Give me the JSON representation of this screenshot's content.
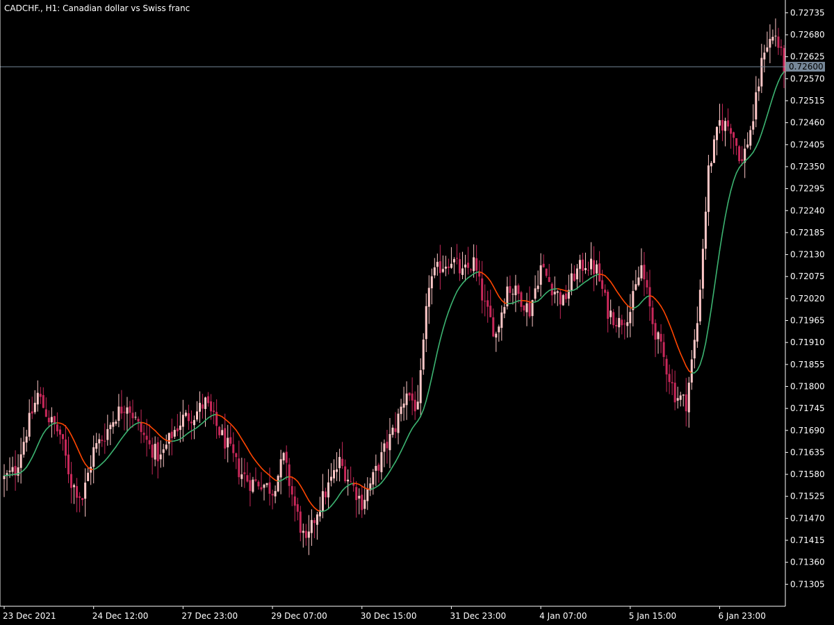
{
  "chart_data": {
    "type": "candlestick",
    "title": "CADCHF., H1:  Canadian dollar vs Swiss franc",
    "symbol": "CADCHF.",
    "timeframe": "H1",
    "description": "Canadian dollar vs Swiss franc",
    "current_price_label": "0.72600",
    "current_price": 0.726,
    "ylim": [
      0.7125,
      0.7276
    ],
    "y_ticks": [
      "0.72735",
      "0.72680",
      "0.72625",
      "0.72570",
      "0.72515",
      "0.72460",
      "0.72405",
      "0.72350",
      "0.72295",
      "0.72240",
      "0.72185",
      "0.72130",
      "0.72075",
      "0.72020",
      "0.71965",
      "0.71910",
      "0.71855",
      "0.71800",
      "0.71745",
      "0.71690",
      "0.71635",
      "0.71580",
      "0.71525",
      "0.71470",
      "0.71415",
      "0.71360",
      "0.71305"
    ],
    "x_ticks": [
      "23 Dec 2021",
      "24 Dec 12:00",
      "27 Dec 23:00",
      "29 Dec 07:00",
      "30 Dec 15:00",
      "31 Dec 23:00",
      "4 Jan 07:00",
      "5 Jan 15:00",
      "6 Jan 23:00"
    ],
    "x_tick_bars": [
      0,
      32,
      64,
      96,
      128,
      160,
      192,
      224,
      256
    ],
    "bar_count": 280,
    "path_points": [
      [
        0,
        0.7157
      ],
      [
        4,
        0.7159
      ],
      [
        8,
        0.7169
      ],
      [
        12,
        0.7178
      ],
      [
        16,
        0.7172
      ],
      [
        20,
        0.7168
      ],
      [
        24,
        0.7156
      ],
      [
        28,
        0.7152
      ],
      [
        32,
        0.7164
      ],
      [
        36,
        0.7168
      ],
      [
        40,
        0.7173
      ],
      [
        44,
        0.7176
      ],
      [
        48,
        0.717
      ],
      [
        52,
        0.7165
      ],
      [
        56,
        0.7162
      ],
      [
        60,
        0.7168
      ],
      [
        64,
        0.7172
      ],
      [
        68,
        0.7173
      ],
      [
        72,
        0.7176
      ],
      [
        76,
        0.717
      ],
      [
        80,
        0.7165
      ],
      [
        84,
        0.7159
      ],
      [
        88,
        0.7156
      ],
      [
        92,
        0.7156
      ],
      [
        96,
        0.7154
      ],
      [
        100,
        0.7162
      ],
      [
        104,
        0.715
      ],
      [
        108,
        0.714
      ],
      [
        112,
        0.7149
      ],
      [
        116,
        0.7155
      ],
      [
        120,
        0.7161
      ],
      [
        124,
        0.7156
      ],
      [
        128,
        0.7151
      ],
      [
        132,
        0.7157
      ],
      [
        136,
        0.7164
      ],
      [
        140,
        0.717
      ],
      [
        144,
        0.7179
      ],
      [
        148,
        0.7174
      ],
      [
        152,
        0.7206
      ],
      [
        156,
        0.721
      ],
      [
        160,
        0.7212
      ],
      [
        164,
        0.7208
      ],
      [
        168,
        0.7211
      ],
      [
        172,
        0.72
      ],
      [
        176,
        0.7193
      ],
      [
        180,
        0.7205
      ],
      [
        184,
        0.7203
      ],
      [
        188,
        0.7199
      ],
      [
        192,
        0.721
      ],
      [
        196,
        0.7205
      ],
      [
        200,
        0.7201
      ],
      [
        204,
        0.7208
      ],
      [
        208,
        0.7211
      ],
      [
        212,
        0.7209
      ],
      [
        216,
        0.7199
      ],
      [
        220,
        0.7196
      ],
      [
        224,
        0.7199
      ],
      [
        228,
        0.721
      ],
      [
        232,
        0.7196
      ],
      [
        236,
        0.7187
      ],
      [
        240,
        0.7178
      ],
      [
        244,
        0.7176
      ],
      [
        248,
        0.7196
      ],
      [
        252,
        0.7234
      ],
      [
        256,
        0.7246
      ],
      [
        260,
        0.7245
      ],
      [
        264,
        0.7236
      ],
      [
        268,
        0.7247
      ],
      [
        272,
        0.7265
      ],
      [
        276,
        0.7268
      ],
      [
        279,
        0.726
      ]
    ],
    "series": [
      {
        "kind": "candles",
        "bull_color": "#ffc8c8",
        "bear_color": "#c8285a"
      },
      {
        "kind": "moving-average",
        "up_color": "#3cb371",
        "down_color": "#ff4500"
      }
    ]
  },
  "colors": {
    "background": "#000000",
    "axis": "#ffffff",
    "price_line": "#778899",
    "badge_bg": "#778899"
  }
}
